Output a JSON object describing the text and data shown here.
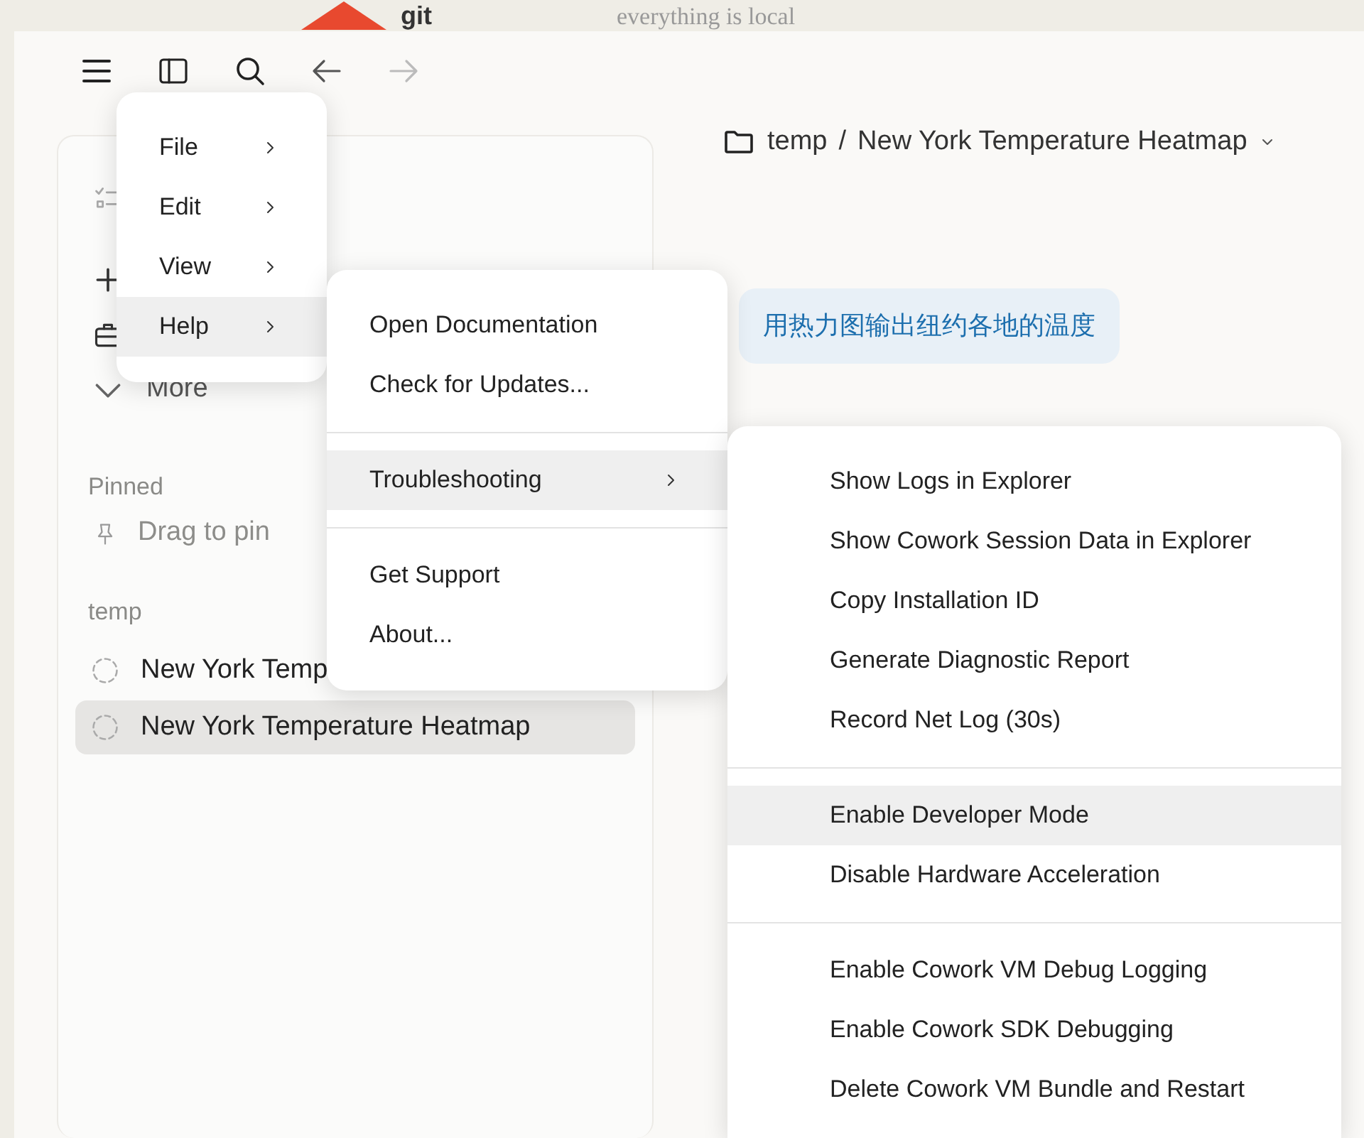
{
  "background": {
    "logo_text": "git",
    "tagline": "everything is local"
  },
  "toolbar": [
    {
      "kind": "menu",
      "disabled": false
    },
    {
      "kind": "sidebar",
      "disabled": false
    },
    {
      "kind": "search",
      "disabled": false
    },
    {
      "kind": "back",
      "disabled": false
    },
    {
      "kind": "forward",
      "disabled": true
    }
  ],
  "sidebar": {
    "nav": [
      {
        "kind": "tasks"
      },
      {
        "kind": "new"
      },
      {
        "kind": "projects"
      },
      {
        "kind": "more",
        "label": "More"
      }
    ],
    "pinned": {
      "heading": "Pinned",
      "placeholder": "Drag to pin"
    },
    "groups": [
      {
        "heading": "temp",
        "items": [
          {
            "title": "New York Temp",
            "selected": false
          },
          {
            "title": "New York Temperature Heatmap",
            "selected": true
          }
        ]
      }
    ]
  },
  "main": {
    "breadcrumb": {
      "folder": "temp",
      "separator": "/",
      "title": "New York Temperature Heatmap"
    },
    "messages": [
      {
        "text": "用热力图输出纽约各地的温度"
      }
    ]
  },
  "menus": [
    {
      "items": [
        {
          "kind": "item",
          "label": "File",
          "submenu": true,
          "selected": false
        },
        {
          "kind": "item",
          "label": "Edit",
          "submenu": true,
          "selected": false
        },
        {
          "kind": "item",
          "label": "View",
          "submenu": true,
          "selected": false
        },
        {
          "kind": "item",
          "label": "Help",
          "submenu": true,
          "selected": true
        }
      ]
    },
    {
      "items": [
        {
          "kind": "item",
          "label": "Open Documentation",
          "submenu": false,
          "selected": false
        },
        {
          "kind": "item",
          "label": "Check for Updates...",
          "submenu": false,
          "selected": false
        },
        {
          "kind": "separator"
        },
        {
          "kind": "item",
          "label": "Troubleshooting",
          "submenu": true,
          "selected": true
        },
        {
          "kind": "separator"
        },
        {
          "kind": "item",
          "label": "Get Support",
          "submenu": false,
          "selected": false
        },
        {
          "kind": "item",
          "label": "About...",
          "submenu": false,
          "selected": false
        }
      ]
    },
    {
      "items": [
        {
          "kind": "item",
          "label": "Show Logs in Explorer",
          "submenu": false,
          "selected": false
        },
        {
          "kind": "item",
          "label": "Show Cowork Session Data in Explorer",
          "submenu": false,
          "selected": false
        },
        {
          "kind": "item",
          "label": "Copy Installation ID",
          "submenu": false,
          "selected": false
        },
        {
          "kind": "item",
          "label": "Generate Diagnostic Report",
          "submenu": false,
          "selected": false
        },
        {
          "kind": "item",
          "label": "Record Net Log (30s)",
          "submenu": false,
          "selected": false
        },
        {
          "kind": "separator"
        },
        {
          "kind": "item",
          "label": "Enable Developer Mode",
          "submenu": false,
          "selected": true
        },
        {
          "kind": "item",
          "label": "Disable Hardware Acceleration",
          "submenu": false,
          "selected": false
        },
        {
          "kind": "separator"
        },
        {
          "kind": "item",
          "label": "Enable Cowork VM Debug Logging",
          "submenu": false,
          "selected": false
        },
        {
          "kind": "item",
          "label": "Enable Cowork SDK Debugging",
          "submenu": false,
          "selected": false
        },
        {
          "kind": "item",
          "label": "Delete Cowork VM Bundle and Restart",
          "submenu": false,
          "selected": false
        }
      ]
    }
  ]
}
